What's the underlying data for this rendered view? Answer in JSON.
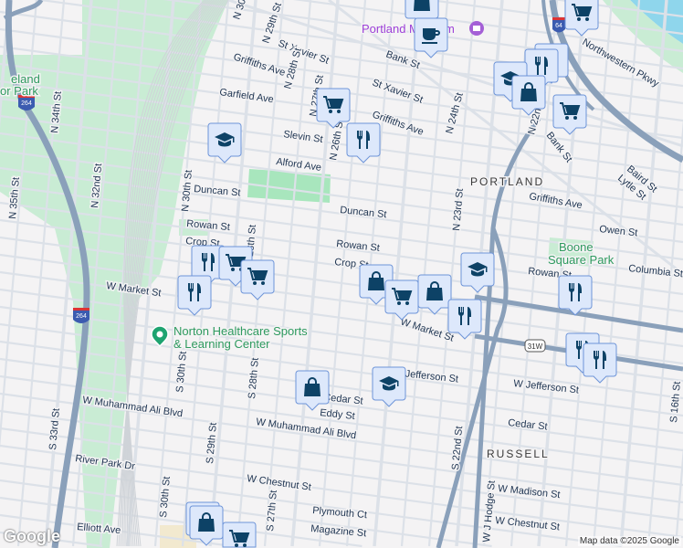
{
  "map": {
    "districts": [
      "PORTLAND",
      "RUSSELL"
    ],
    "parks": [
      "eland",
      "or Park",
      "Boone",
      "Square Park"
    ],
    "places": {
      "museum": "Portland Museum",
      "sports_center_line1": "Norton Healthcare Sports",
      "sports_center_line2": "& Learning Center"
    },
    "streets": [
      "N 30th St",
      "N 29th St",
      "St Xavier St",
      "Griffiths Ave",
      "N 28th St",
      "Garfield Ave",
      "N 27th St",
      "Slevin St",
      "N 26th St",
      "Alford Ave",
      "Duncan St",
      "N 30th St",
      "Rowan St",
      "Crop St",
      "N 28th St",
      "W Market St",
      "N 34th St",
      "N 35th St",
      "N 32nd St",
      "Bank St",
      "St Xavier St",
      "Griffiths Ave",
      "N 24th St",
      "Bank St",
      "Northwestern Pkwy",
      "Baird St",
      "Lytle St",
      "Griffiths Ave",
      "Owen St",
      "Duncan St",
      "N 23rd St",
      "Rowan St",
      "Crop St",
      "Columbia St",
      "Rowan St",
      "W Market St",
      "W Jefferson St",
      "W Jefferson St",
      "Cedar St",
      "Eddy St",
      "Cedar St",
      "S 16th St",
      "W Muhammad Ali Blvd",
      "W Muhammad Ali Blvd",
      "S 33rd St",
      "River Park Dr",
      "S 29th St",
      "S 28th St",
      "S 30th St",
      "S 30th St",
      "W Chestnut St",
      "S 27th St",
      "S 22nd St",
      "W J Hodge St",
      "W Madison St",
      "W Chestnut St",
      "Plymouth Ct",
      "Magazine St",
      "Elliott Ave",
      "N 22nd St"
    ],
    "shields": [
      "264",
      "264",
      "64",
      "31W"
    ],
    "markers": [
      "shopping",
      "coffee",
      "grocery",
      "restaurant",
      "restaurant",
      "school",
      "shopping",
      "grocery",
      "grocery",
      "restaurant",
      "school",
      "restaurant",
      "grocery",
      "grocery",
      "restaurant",
      "shopping",
      "grocery",
      "school",
      "shopping",
      "restaurant",
      "restaurant",
      "restaurant",
      "restaurant",
      "school",
      "shopping",
      "shopping",
      "shopping",
      "grocery"
    ],
    "colors": {
      "marker_fill": "#dde8fb",
      "marker_border": "#6d94d8",
      "marker_icon": "#0d4266",
      "highway": "#8aa0ba",
      "park": "#c9ecd4"
    }
  },
  "footer": {
    "credit": "Map data ©2025 Google",
    "logo": "Google"
  }
}
